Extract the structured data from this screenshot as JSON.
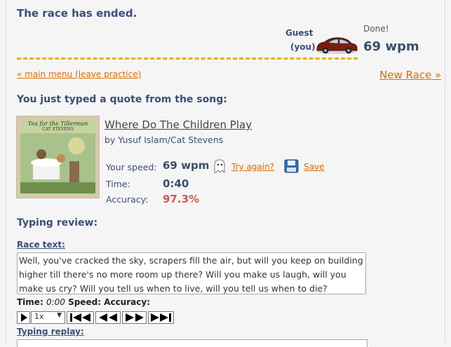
{
  "race": {
    "status": "The race has ended.",
    "player_name": "Guest",
    "player_tag": "(you)",
    "done_label": "Done!",
    "wpm": "69 wpm"
  },
  "nav": {
    "main_menu": "« main menu (leave practice)",
    "new_race": "New Race »"
  },
  "quote": {
    "heading": "You just typed a quote from the song:",
    "title": "Where Do The Children Play",
    "artist": "by Yusuf Islam/Cat Stevens",
    "album_text_line1": "Tea for the Tillerman",
    "album_text_line2": "CAT STEVENS"
  },
  "stats": {
    "speed_label": "Your speed:",
    "speed_value": "69 wpm",
    "try_again": "Try again?",
    "save": "Save",
    "time_label": "Time:",
    "time_value": "0:40",
    "accuracy_label": "Accuracy:",
    "accuracy_value": "97.3%"
  },
  "review": {
    "heading": "Typing review:",
    "race_text_label": "Race text:",
    "race_text": "Well, you've cracked the sky, scrapers fill the air, but will you keep on building higher till there's no more room up there? Will you make us laugh, will you make us cry? Will you tell us when to live, will you tell us when to die?",
    "time_label": "Time:",
    "time_value": "0:00",
    "speed_label": "Speed:",
    "accuracy_label": "Accuracy:",
    "speed_select": "1x",
    "typing_replay_label": "Typing replay:"
  },
  "colors": {
    "heading": "#3a4f7a",
    "link": "#e06c00",
    "accuracy": "#d9534f",
    "track": "#e8b010"
  }
}
